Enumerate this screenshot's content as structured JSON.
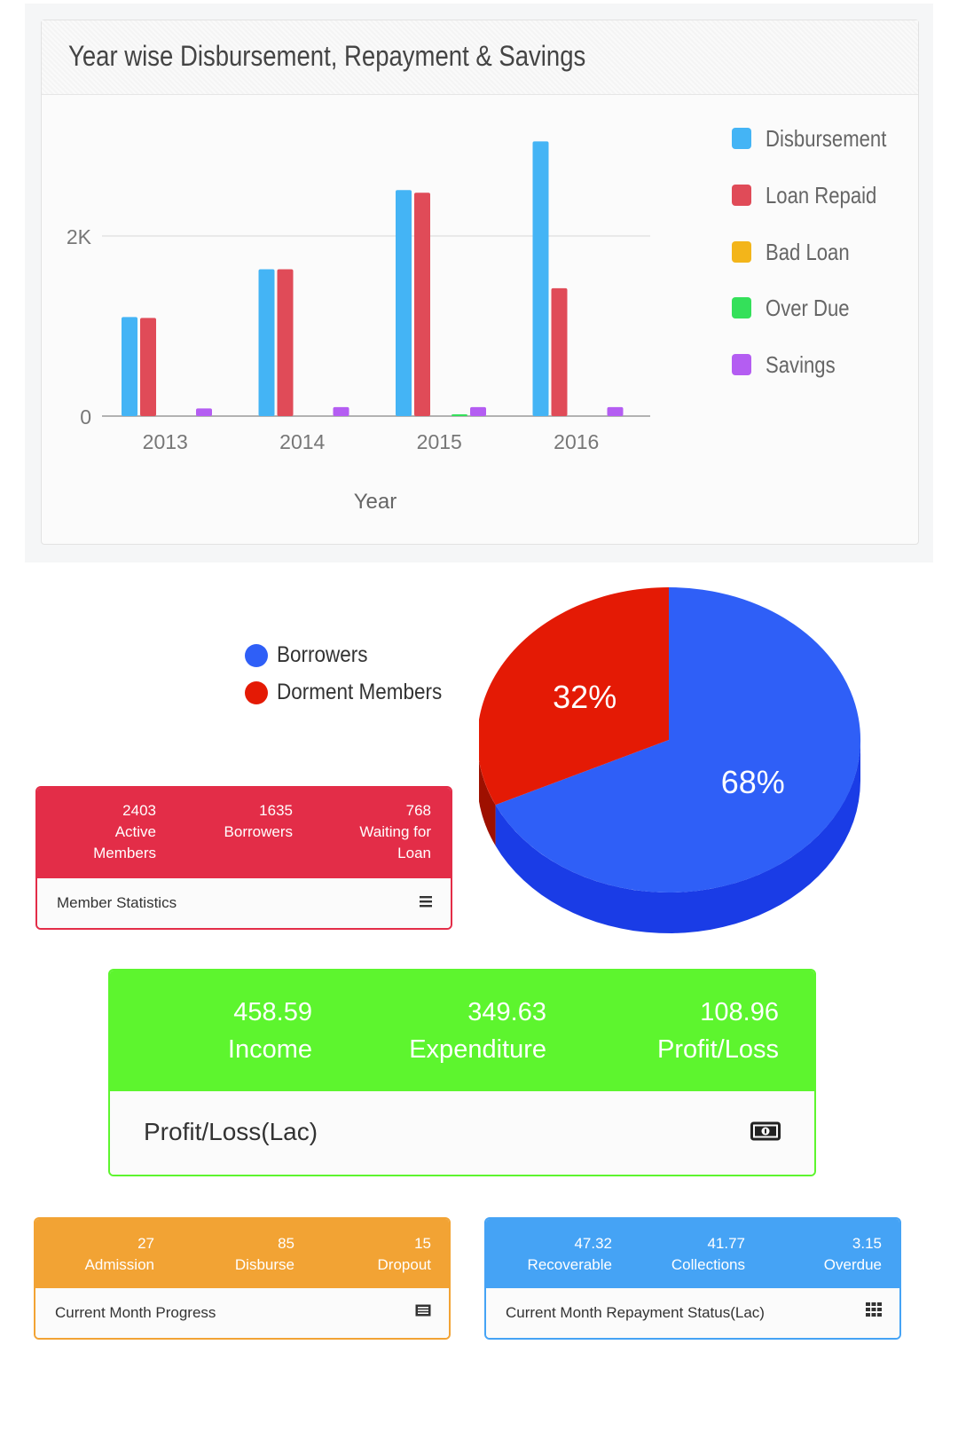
{
  "chart_data": [
    {
      "type": "bar",
      "title": "Year wise Disbursement, Repayment & Savings",
      "xlabel": "Year",
      "ylabel": "",
      "categories": [
        "2013",
        "2014",
        "2015",
        "2016"
      ],
      "yticks": [
        "0",
        "2K"
      ],
      "ylim": [
        0,
        3100
      ],
      "grid": true,
      "legend_position": "right",
      "series": [
        {
          "name": "Disbursement",
          "color": "#44b4f5",
          "values": [
            1100,
            1630,
            2510,
            3050
          ]
        },
        {
          "name": "Loan Repaid",
          "color": "#e04b58",
          "values": [
            1090,
            1630,
            2480,
            1420
          ]
        },
        {
          "name": "Bad Loan",
          "color": "#f3b51a",
          "values": [
            0,
            0,
            0,
            0
          ]
        },
        {
          "name": "Over Due",
          "color": "#34e05a",
          "values": [
            0,
            0,
            10,
            0
          ]
        },
        {
          "name": "Savings",
          "color": "#b45df2",
          "values": [
            85,
            100,
            100,
            100
          ]
        }
      ]
    },
    {
      "type": "pie",
      "categories": [
        "Borrowers",
        "Dorment Members"
      ],
      "values": [
        68,
        32
      ],
      "labels": [
        "68%",
        "32%"
      ],
      "colors": [
        "#2f5ff7",
        "#e41a05"
      ],
      "legend_position": "left"
    }
  ],
  "member_stats": {
    "columns": [
      {
        "value": "2403",
        "line1": "Active",
        "line2": "Members"
      },
      {
        "value": "1635",
        "line1": "Borrowers",
        "line2": ""
      },
      {
        "value": "768",
        "line1": "Waiting for",
        "line2": "Loan"
      }
    ],
    "footer": "Member Statistics",
    "icon": "list-icon",
    "color": "#e32d48"
  },
  "profit_loss": {
    "columns": [
      {
        "value": "458.59",
        "label": "Income"
      },
      {
        "value": "349.63",
        "label": "Expenditure"
      },
      {
        "value": "108.96",
        "label": "Profit/Loss"
      }
    ],
    "footer": "Profit/Loss(Lac)",
    "icon": "money-icon",
    "color": "#5df52e"
  },
  "month_progress": {
    "columns": [
      {
        "value": "27",
        "label": "Admission"
      },
      {
        "value": "85",
        "label": "Disburse"
      },
      {
        "value": "15",
        "label": "Dropout"
      }
    ],
    "footer": "Current Month Progress",
    "icon": "list-alt-icon",
    "color": "#f2a334"
  },
  "repayment_status": {
    "columns": [
      {
        "value": "47.32",
        "label": "Recoverable"
      },
      {
        "value": "41.77",
        "label": "Collections"
      },
      {
        "value": "3.15",
        "label": "Overdue"
      }
    ],
    "footer": "Current Month Repayment Status(Lac)",
    "icon": "grid-icon",
    "color": "#45a3f5"
  }
}
